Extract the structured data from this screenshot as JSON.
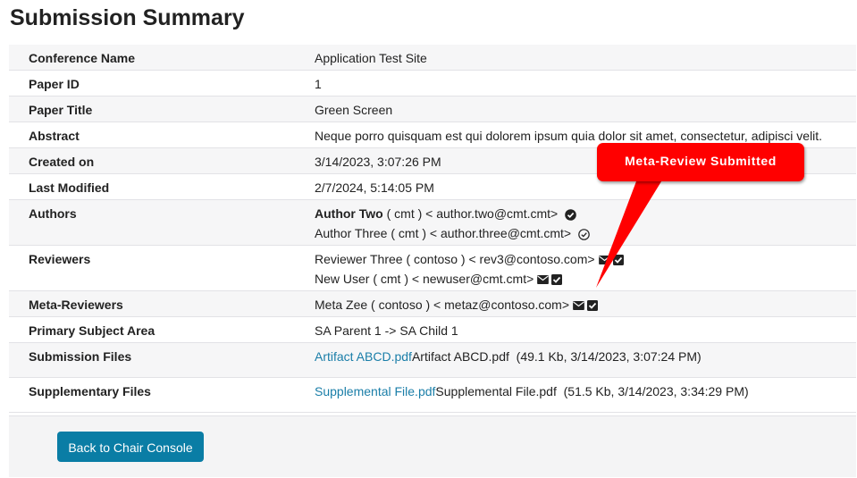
{
  "title": "Submission Summary",
  "rows": [
    {
      "label": "Conference Name",
      "value": "Application Test Site"
    },
    {
      "label": "Paper ID",
      "value": "1"
    },
    {
      "label": "Paper Title",
      "value": "Green Screen"
    },
    {
      "label": "Abstract",
      "value": "Neque porro quisquam est qui dolorem ipsum quia dolor sit amet, consectetur, adipisci velit."
    },
    {
      "label": "Created on",
      "value": "3/14/2023, 3:07:26 PM"
    },
    {
      "label": "Last Modified",
      "value": "2/7/2024, 5:14:05 PM"
    }
  ],
  "authors": {
    "label": "Authors",
    "items": [
      {
        "name": "Author Two",
        "org": " ( cmt ) < author.two@cmt.cmt>",
        "icon": "check-circle-filled-icon"
      },
      {
        "name": "Author Three",
        "org": " ( cmt ) < author.three@cmt.cmt>",
        "icon": "check-circle-outline-icon"
      }
    ]
  },
  "reviewers": {
    "label": "Reviewers",
    "items": [
      "Reviewer Three ( contoso ) < rev3@contoso.com>",
      "New User ( cmt ) < newuser@cmt.cmt>"
    ]
  },
  "meta_reviewers": {
    "label": "Meta-Reviewers",
    "items": [
      "Meta Zee ( contoso ) < metaz@contoso.com>"
    ]
  },
  "subject": {
    "label": "Primary Subject Area",
    "value": "SA Parent 1 -> SA Child 1"
  },
  "submission_files": {
    "label": "Submission Files",
    "link": "Artifact ABCD.pdf",
    "name": "Artifact ABCD.pdf",
    "info": "  (49.1 Kb, 3/14/2023, 3:07:24 PM)"
  },
  "supplementary_files": {
    "label": "Supplementary Files",
    "link": "Supplemental File.pdf",
    "name": "Supplemental File.pdf",
    "info": "  (51.5 Kb, 3/14/2023, 3:34:29 PM)"
  },
  "back_button": "Back to Chair Console",
  "callout": "Meta-Review Submitted",
  "colors": {
    "link": "#1a7ea8",
    "button": "#0a7da5",
    "callout": "#ff0000"
  }
}
